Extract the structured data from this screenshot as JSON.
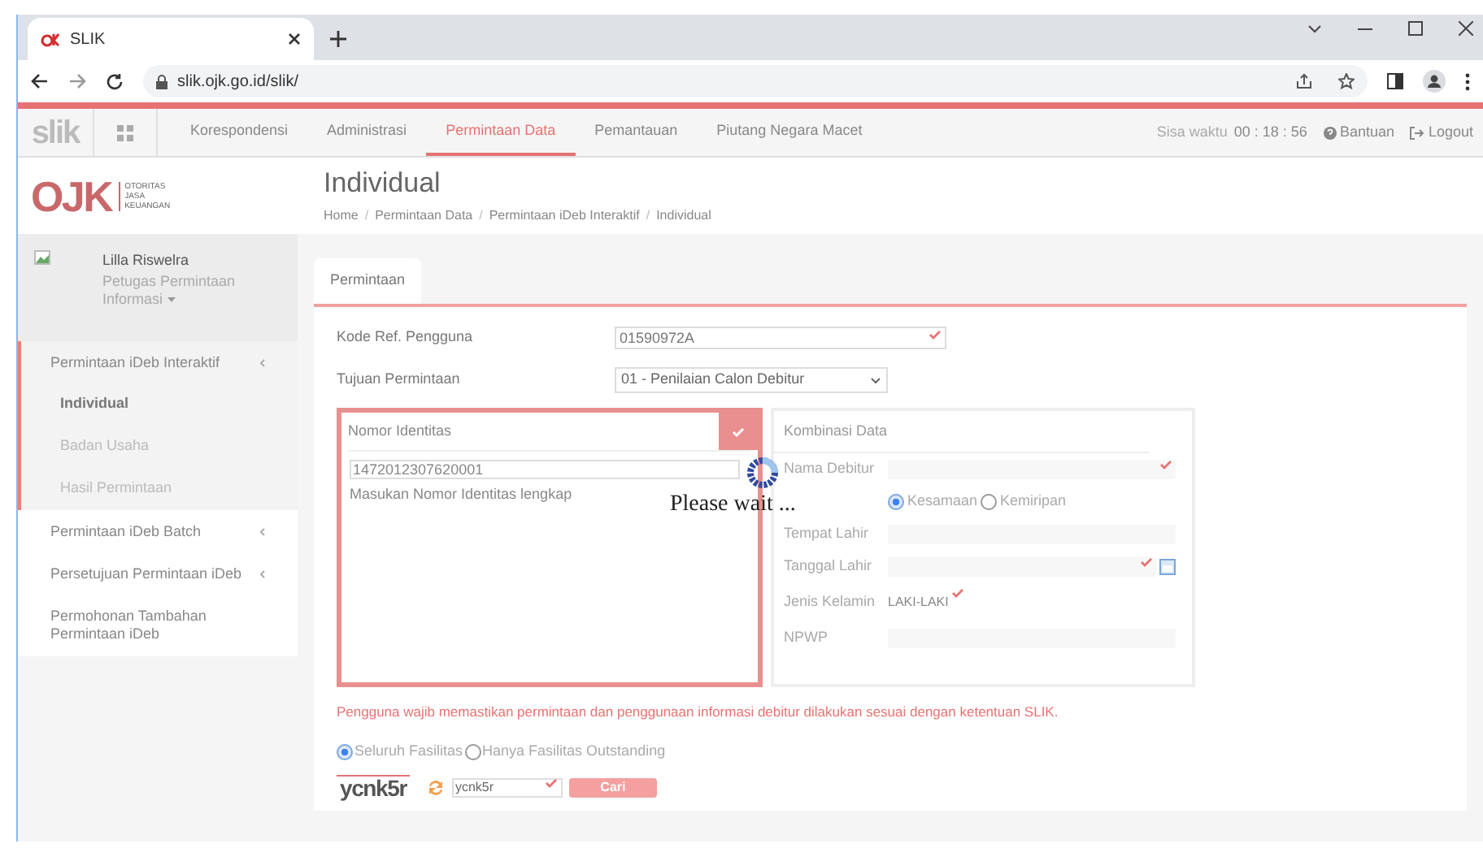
{
  "browser": {
    "tab_title": "SLIK",
    "url": "slik.ojk.go.id/slik/"
  },
  "nav": {
    "logo": "slik",
    "items": [
      {
        "label": "Korespondensi",
        "selected": false
      },
      {
        "label": "Administrasi",
        "selected": false
      },
      {
        "label": "Permintaan Data",
        "selected": true
      },
      {
        "label": "Pemantauan",
        "selected": false
      },
      {
        "label": "Piutang Negara Macet",
        "selected": false
      }
    ],
    "timer_label": "Sisa waktu",
    "timer": "00 : 18 : 56",
    "help": "Bantuan",
    "logout": "Logout"
  },
  "org_logo": {
    "mark": "OJK",
    "lines": [
      "OTORITAS",
      "JASA",
      "KEUANGAN"
    ]
  },
  "user": {
    "name": "Lilla Riswelra",
    "role": "Petugas Permintaan Informasi"
  },
  "sidebar": {
    "items": [
      {
        "label": "Permintaan iDeb Interaktif",
        "expanded": true,
        "has_arrow": true,
        "children": [
          {
            "label": "Individual",
            "selected": true
          },
          {
            "label": "Badan Usaha",
            "selected": false
          },
          {
            "label": "Hasil Permintaan",
            "selected": false
          }
        ]
      },
      {
        "label": "Permintaan iDeb Batch",
        "expanded": false,
        "has_arrow": true
      },
      {
        "label": "Persetujuan Permintaan iDeb",
        "expanded": false,
        "has_arrow": true
      },
      {
        "label": "Permohonan Tambahan Permintaan iDeb",
        "expanded": false,
        "has_arrow": false
      }
    ]
  },
  "page": {
    "title": "Individual",
    "breadcrumb_separator": "/",
    "breadcrumb": [
      "Home",
      "Permintaan Data",
      "Permintaan iDeb Interaktif",
      "Individual"
    ]
  },
  "tabs": [
    {
      "label": "Permintaan",
      "selected": true
    }
  ],
  "form": {
    "kode_ref": {
      "label": "Kode Ref. Pengguna",
      "value": "01590972A"
    },
    "tujuan": {
      "label": "Tujuan Permintaan",
      "value": "01 - Penilaian Calon Debitur"
    }
  },
  "nomor_identitas": {
    "title": "Nomor Identitas",
    "checked": true,
    "value": "1472012307620001",
    "hint": "Masukan Nomor Identitas lengkap"
  },
  "kombinasi": {
    "title": "Kombinasi Data",
    "fields": [
      {
        "kind": "input",
        "label": "Nama Debitur",
        "required": true
      },
      {
        "kind": "radios",
        "options": [
          {
            "label": "Kesamaan",
            "selected": true
          },
          {
            "label": "Kemiripan",
            "selected": false
          }
        ]
      },
      {
        "kind": "input",
        "label": "Tempat Lahir",
        "required": false
      },
      {
        "kind": "date",
        "label": "Tanggal Lahir",
        "required": true
      },
      {
        "kind": "text",
        "label": "Jenis Kelamin",
        "value": "LAKI-LAKI",
        "required": true
      },
      {
        "kind": "input",
        "label": "NPWP",
        "required": false
      }
    ]
  },
  "loading": {
    "text": "Please wait ..."
  },
  "notice": "Pengguna wajib memastikan permintaan dan penggunaan informasi debitur dilakukan sesuai dengan ketentuan SLIK.",
  "scope": [
    {
      "label": "Seluruh Fasilitas",
      "selected": true
    },
    {
      "label": "Hanya Fasilitas Outstanding",
      "selected": false
    }
  ],
  "captcha": {
    "image_text": "ycnk5r",
    "value": "ycnk5r"
  },
  "submit": "Cari"
}
